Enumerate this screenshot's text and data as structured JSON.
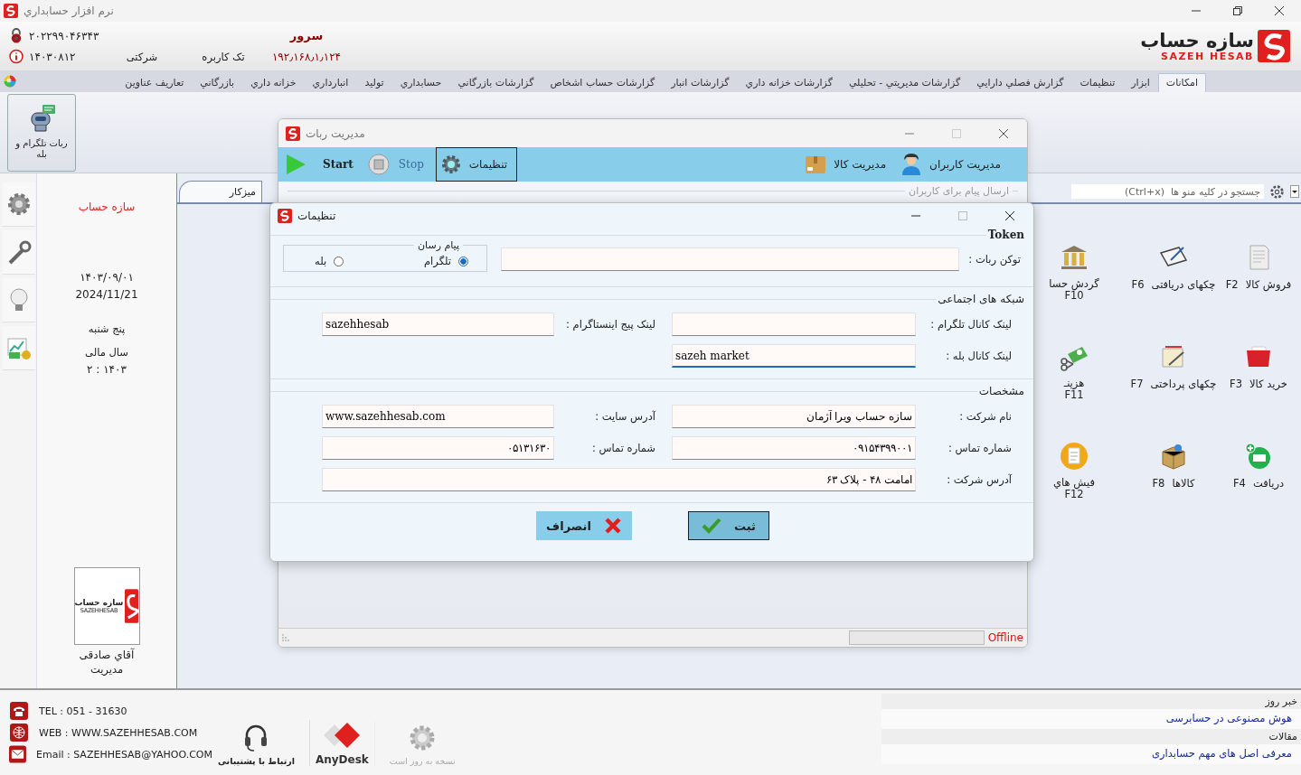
{
  "window": {
    "title": "نرم افزار حسابداري"
  },
  "header": {
    "serial": "۲۰۲۲۹۹۰۴۶۳۴۳",
    "date_code": "۱۴۰۳۰۸۱۲",
    "license_type": "شرکتی",
    "user_mode": "تک کاربره",
    "server_label": "سرور",
    "server_ip": "۱۹۲٫۱۶۸٫۱٫۱۲۴"
  },
  "logo": {
    "name": "سازه حساب",
    "latin": "SAZEH HESAB"
  },
  "menu_tabs": [
    {
      "label": "امکانات",
      "selected": true
    },
    {
      "label": "ابزار",
      "selected": false
    },
    {
      "label": "تنظیمات",
      "selected": false
    },
    {
      "label": "گزارش فصلي دارايي",
      "selected": false
    },
    {
      "label": "گزارشات مديريتي - تحليلي",
      "selected": false
    },
    {
      "label": "گزارشات خزانه داري",
      "selected": false
    },
    {
      "label": "گزارشات انبار",
      "selected": false
    },
    {
      "label": "گزارشات حساب اشخاص",
      "selected": false
    },
    {
      "label": "گزارشات بازرگاني",
      "selected": false
    },
    {
      "label": "حسابداري",
      "selected": false
    },
    {
      "label": "توليد",
      "selected": false
    },
    {
      "label": "انبارداري",
      "selected": false
    },
    {
      "label": "خزانه داري",
      "selected": false
    },
    {
      "label": "بازرگاني",
      "selected": false
    },
    {
      "label": "تعاريف عناوين",
      "selected": false
    }
  ],
  "ribbon": [
    {
      "label": "ربات تلگرام و بله"
    }
  ],
  "info_panel": {
    "company": "سازه حساب",
    "date_fa": "۱۴۰۳/۰۹/۰۱",
    "date_en": "2024/11/21",
    "weekday": "پنج شنبه",
    "fiscal_label": "سال مالی",
    "fiscal_year": "۲ : ۱۴۰۳",
    "user_logo": {
      "name": "سازه حساب",
      "latin": "SAZEHHESAB"
    },
    "user_name": "آقاي صادقی",
    "user_role": "مدیریت"
  },
  "workspace": {
    "tab": "میزکار",
    "search_placeholder": "جستجو در کلیه منو ها  (Ctrl+x)",
    "shortcuts": [
      {
        "key": "F2",
        "label": "فروش کالا"
      },
      {
        "key": "F3",
        "label": "خرید کالا"
      },
      {
        "key": "F4",
        "label": "دریافت"
      },
      {
        "key": "F6",
        "label": "چکهای دریافتی"
      },
      {
        "key": "F7",
        "label": "چکهای پرداختی"
      },
      {
        "key": "F8",
        "label": "کالاها"
      },
      {
        "key": "F10",
        "label": "گردش حسا"
      },
      {
        "key": "F11",
        "label": "هزینـ"
      },
      {
        "key": "F12",
        "label": "فیش هاي"
      }
    ]
  },
  "robot_window": {
    "title": "مدیریت ربات",
    "toolbar": [
      {
        "kind": "users",
        "label": "مدیریت کاربران",
        "selected": false
      },
      {
        "kind": "goods",
        "label": "مدیریت کالا",
        "selected": false
      },
      {
        "kind": "settings",
        "label": "تنظیمات",
        "selected": true
      },
      {
        "kind": "stop",
        "label": "Stop",
        "selected": false
      },
      {
        "kind": "start",
        "label": "Start",
        "selected": false
      }
    ],
    "group_label": "ارسال پیام برای کاربران",
    "status": "Offline"
  },
  "settings_window": {
    "title": "تنظیمات",
    "token": {
      "title": "Token",
      "label": "توکن ربات :"
    },
    "messenger": {
      "title": "پیام رسان",
      "options": [
        {
          "label": "تلگرام",
          "selected": true
        },
        {
          "label": "بله",
          "selected": false
        }
      ]
    },
    "social": {
      "title": "شبکه های اجتماعی",
      "fields": [
        {
          "label": "لینک کانال تلگرام :",
          "focused": false
        },
        {
          "label": "لینک پیج اینستاگرام :",
          "value": "sazehhesab",
          "focused": false
        },
        {
          "label": "لینک کانال بله :",
          "value": "sazeh market",
          "focused": true
        }
      ]
    },
    "details": {
      "title": "مشخصات",
      "fields": [
        {
          "label": "نام شرکت :",
          "value": "سازه حساب ویرا آژمان",
          "wide": false
        },
        {
          "label": "آدرس سایت :",
          "value": "www.sazehhesab.com",
          "wide": false
        },
        {
          "label": "شماره تماس :",
          "value": "۰۹۱۵۴۳۹۹۰۰۱",
          "wide": false
        },
        {
          "label": "شماره تماس :",
          "value": "۰۵۱۳۱۶۳۰",
          "wide": false
        },
        {
          "label": "آدرس شرکت :",
          "value": "امامت ۴۸ - پلاک ۶۳",
          "wide": true
        }
      ]
    },
    "buttons": [
      {
        "kind": "save",
        "label": "ثبت"
      },
      {
        "kind": "cancel",
        "label": "انصراف"
      }
    ]
  },
  "footer": {
    "contacts": [
      {
        "text": "TEL : 051 - 31630"
      },
      {
        "text": "WEB : WWW.SAZEHHESAB.COM"
      },
      {
        "text": "Email : SAZEHHESAB@YAHOO.COM"
      }
    ],
    "tools": [
      {
        "label": "نسخه به روز است",
        "disabled": true
      },
      {
        "label": "AnyDesk",
        "disabled": false
      },
      {
        "label": "ارتباط با پشتیبانی",
        "disabled": false
      }
    ]
  },
  "news": [
    {
      "heading": "خبر روز",
      "link": "هوش مصنوعی در حسابرسی"
    },
    {
      "heading": "مقالات",
      "link": "معرفی اصل های مهم حسابداری"
    }
  ]
}
